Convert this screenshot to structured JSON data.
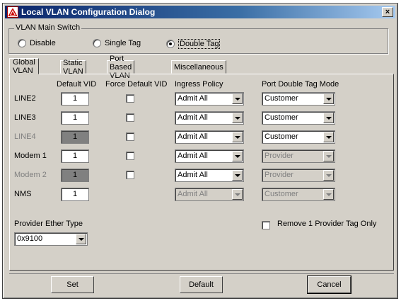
{
  "window": {
    "title": "Local VLAN Configuration Dialog",
    "close_glyph": "×"
  },
  "main_switch": {
    "label": "VLAN Main Switch",
    "options": [
      {
        "label": "Disable",
        "selected": false
      },
      {
        "label": "Single Tag",
        "selected": false
      },
      {
        "label": "Double Tag",
        "selected": true
      }
    ]
  },
  "tabs": [
    {
      "label": "Global VLAN",
      "active": true
    },
    {
      "label": "Static VLAN",
      "active": false
    },
    {
      "label": "Port Based VLAN",
      "active": false
    },
    {
      "label": "Miscellaneous",
      "active": false
    }
  ],
  "columns": {
    "default_vid": "Default VID",
    "force_default_vid": "Force Default VID",
    "ingress_policy": "Ingress Policy",
    "port_double_tag_mode": "Port Double Tag Mode"
  },
  "rows": [
    {
      "name": "LINE2",
      "name_disabled": false,
      "vid": "1",
      "vid_disabled": false,
      "force": false,
      "ingress": "Admit All",
      "ingress_disabled": false,
      "mode": "Customer",
      "mode_disabled": false
    },
    {
      "name": "LINE3",
      "name_disabled": false,
      "vid": "1",
      "vid_disabled": false,
      "force": false,
      "ingress": "Admit All",
      "ingress_disabled": false,
      "mode": "Customer",
      "mode_disabled": false
    },
    {
      "name": "LINE4",
      "name_disabled": true,
      "vid": "1",
      "vid_disabled": true,
      "force": false,
      "ingress": "Admit All",
      "ingress_disabled": false,
      "mode": "Customer",
      "mode_disabled": false
    },
    {
      "name": "Modem 1",
      "name_disabled": false,
      "vid": "1",
      "vid_disabled": false,
      "force": false,
      "ingress": "Admit All",
      "ingress_disabled": false,
      "mode": "Provider",
      "mode_disabled": true
    },
    {
      "name": "Modem 2",
      "name_disabled": true,
      "vid": "1",
      "vid_disabled": true,
      "force": false,
      "ingress": "Admit All",
      "ingress_disabled": false,
      "mode": "Provider",
      "mode_disabled": true
    },
    {
      "name": "NMS",
      "name_disabled": false,
      "vid": "1",
      "vid_disabled": false,
      "force": null,
      "ingress": "Admit All",
      "ingress_disabled": true,
      "mode": "Customer",
      "mode_disabled": true
    }
  ],
  "provider_ether_type": {
    "label": "Provider Ether Type",
    "value": "0x9100"
  },
  "remove_provider_tag": {
    "label": "Remove 1 Provider Tag Only",
    "checked": false
  },
  "buttons": {
    "set": "Set",
    "default": "Default",
    "cancel": "Cancel"
  },
  "colors": {
    "titlebar_start": "#0a246a",
    "titlebar_end": "#a6caf0",
    "face": "#d4d0c8",
    "disabled": "#808080"
  }
}
